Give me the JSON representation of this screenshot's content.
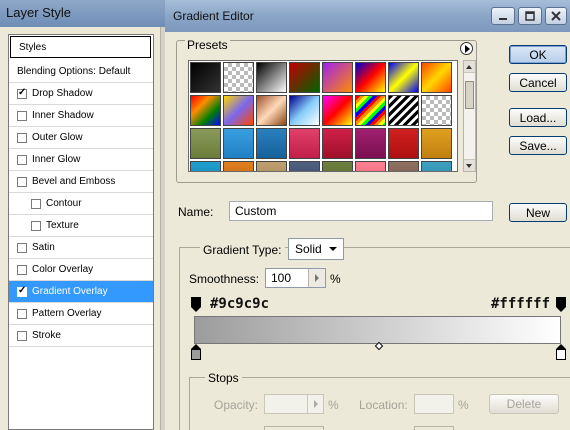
{
  "layer_style": {
    "title": "Layer Style",
    "styles_header": "Styles",
    "items": [
      {
        "label": "Blending Options: Default",
        "checkbox": false,
        "checked": false,
        "selected": false,
        "indent": 0
      },
      {
        "label": "Drop Shadow",
        "checkbox": true,
        "checked": true,
        "selected": false,
        "indent": 0
      },
      {
        "label": "Inner Shadow",
        "checkbox": true,
        "checked": false,
        "selected": false,
        "indent": 0
      },
      {
        "label": "Outer Glow",
        "checkbox": true,
        "checked": false,
        "selected": false,
        "indent": 0
      },
      {
        "label": "Inner Glow",
        "checkbox": true,
        "checked": false,
        "selected": false,
        "indent": 0
      },
      {
        "label": "Bevel and Emboss",
        "checkbox": true,
        "checked": false,
        "selected": false,
        "indent": 0
      },
      {
        "label": "Contour",
        "checkbox": true,
        "checked": false,
        "selected": false,
        "indent": 1
      },
      {
        "label": "Texture",
        "checkbox": true,
        "checked": false,
        "selected": false,
        "indent": 1
      },
      {
        "label": "Satin",
        "checkbox": true,
        "checked": false,
        "selected": false,
        "indent": 0
      },
      {
        "label": "Color Overlay",
        "checkbox": true,
        "checked": false,
        "selected": false,
        "indent": 0
      },
      {
        "label": "Gradient Overlay",
        "checkbox": true,
        "checked": true,
        "selected": true,
        "indent": 0
      },
      {
        "label": "Pattern Overlay",
        "checkbox": true,
        "checked": false,
        "selected": false,
        "indent": 0
      },
      {
        "label": "Stroke",
        "checkbox": true,
        "checked": false,
        "selected": false,
        "indent": 0
      }
    ]
  },
  "gradient_editor": {
    "title": "Gradient Editor",
    "window_buttons": [
      "minimize-icon",
      "maximize-icon",
      "close-icon"
    ],
    "presets": {
      "label": "Presets",
      "menu_icon": "flyout-arrow-icon",
      "swatches": [
        "linear-gradient(135deg,#000,#333)",
        "repeating-conic-gradient(#bbb 0 25%,#fff 0 50%) 0 0/8px 8px",
        "linear-gradient(135deg,#000,#fff)",
        "linear-gradient(135deg,#c00000,#006400)",
        "linear-gradient(135deg,#a020f0,#ff8c00)",
        "linear-gradient(135deg,#0000cd,#ff0000,#ffff00)",
        "linear-gradient(135deg,#0000ff,#ffff00,#0000ff)",
        "linear-gradient(135deg,#ff4500,#ffd700,#ff4500)",
        "linear-gradient(135deg,#ff0000,#ff8c00,#008000,#0000ff)",
        "linear-gradient(135deg,#ffd700,#7b68ee,#ff4500)",
        "linear-gradient(135deg,#a0522d,#ffdab9,#8b4513)",
        "linear-gradient(135deg,#00008b,#87cefa,#ffffff)",
        "linear-gradient(135deg,#ff00ff,#ff0000,#ffff00)",
        "repeating-linear-gradient(135deg,#ff0000 0 3px,#ff8c00 3px 6px,#ffff00 6px 9px,#00ff00 9px 12px,#0000ff 12px 15px)",
        "repeating-linear-gradient(135deg,#000 0 3px,#fff 3px 6px)",
        "repeating-conic-gradient(#bbb 0 25%,#fff 0 50%) 0 0/8px 8px",
        "linear-gradient(#8a9a5b,#6b7d3a)",
        "linear-gradient(#3aa0e0,#1f7fc4)",
        "linear-gradient(#2a80c0,#16619a)",
        "linear-gradient(#e0406a,#c01f4a)",
        "linear-gradient(#d0204a,#a0102a)",
        "linear-gradient(#a02070,#7a1050)",
        "linear-gradient(#d02020,#b01010)",
        "linear-gradient(#e0a020,#c08010)",
        "linear-gradient(#20a0d0,#1080b0)",
        "linear-gradient(#e08020,#c06010)",
        "linear-gradient(#c0a070,#a08050)",
        "linear-gradient(#506080,#304060)",
        "linear-gradient(#708040,#506020)",
        "linear-gradient(#ff8090,#e06070)",
        "linear-gradient(#907060,#705040)",
        "linear-gradient(#40a0c0,#2080a0)"
      ]
    },
    "buttons": {
      "ok": "OK",
      "cancel": "Cancel",
      "load": "Load...",
      "save": "Save...",
      "new": "New"
    },
    "name": {
      "label": "Name:",
      "value": "Custom"
    },
    "gradient_type": {
      "label": "Gradient Type:",
      "value": "Solid"
    },
    "smoothness": {
      "label": "Smoothness:",
      "value": "100",
      "unit": "%"
    },
    "gradient": {
      "start_color": "#9c9c9c",
      "end_color": "#ffffff",
      "start_hex_label": "#9c9c9c",
      "end_hex_label": "#ffffff"
    },
    "stops": {
      "label": "Stops",
      "opacity_label": "Opacity:",
      "opacity_unit": "%",
      "location_label": "Location:",
      "location_unit": "%",
      "delete_label": "Delete"
    }
  }
}
